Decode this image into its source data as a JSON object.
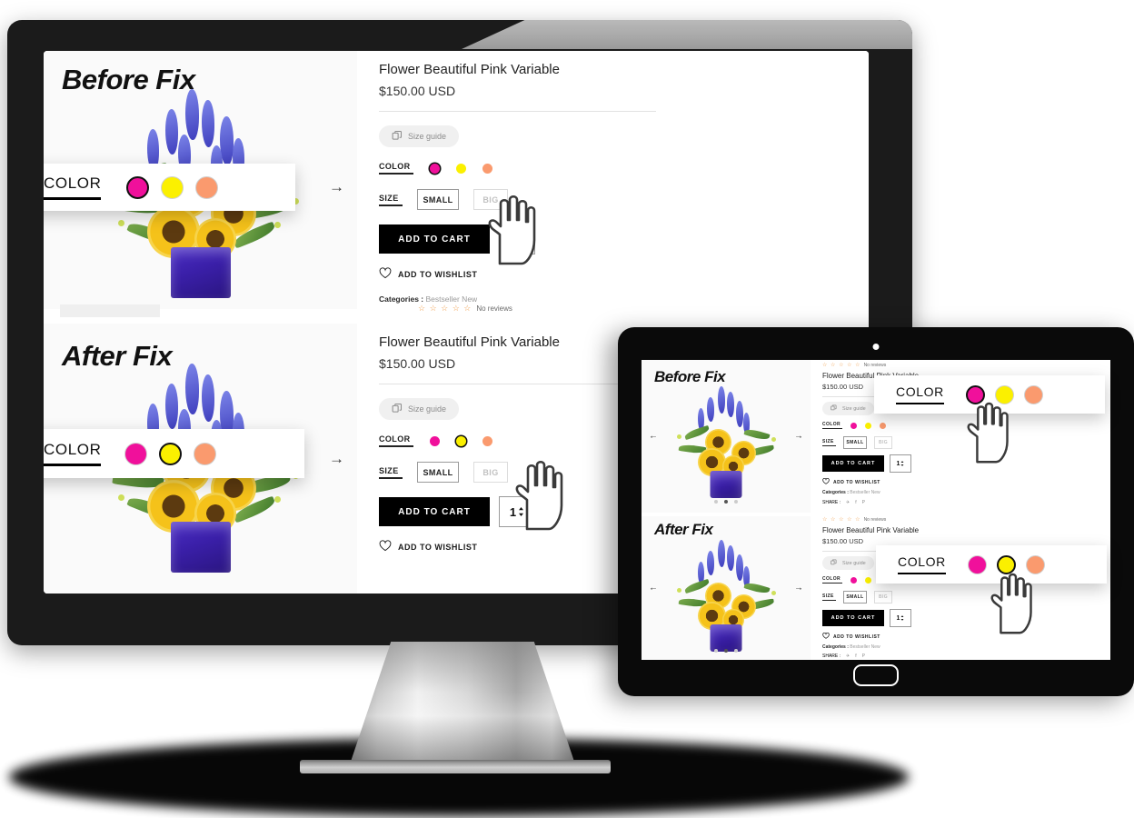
{
  "devices": {
    "monitor": {
      "name": "desktop-monitor"
    },
    "tablet": {
      "name": "tablet-device"
    }
  },
  "labels": {
    "before_fix": "Before Fix",
    "after_fix": "After Fix"
  },
  "product": {
    "title": "Flower Beautiful Pink Variable",
    "price": "$150.00 USD",
    "size_guide": "Size guide",
    "color_label": "COLOR",
    "size_label": "SIZE",
    "size_options": [
      "SMALL",
      "BIG"
    ],
    "add_to_cart": "ADD TO CART",
    "quantity": "1",
    "wishlist": "ADD TO WISHLIST",
    "categories_key": "Categories :",
    "categories_value": "Bestseller New",
    "share_key": "SHARE :",
    "share_icons": [
      "twitter-icon",
      "facebook-icon",
      "pinterest-icon"
    ],
    "reviews_text": "No reviews",
    "stars": "☆ ☆ ☆ ☆ ☆",
    "prev_arrow": "←",
    "next_arrow": "→"
  },
  "colors": {
    "pink": "#F0109B",
    "yellow": "#FBF000",
    "orange": "#FA9A6E",
    "swatch_ring": "#D6D6D6",
    "accent_black": "#000000",
    "bezel": "#1B1B1B",
    "tablet_bezel": "#0A0A0A",
    "page_bg": "#FFFFFF",
    "media_bg": "#FAFAFA"
  },
  "callouts": [
    {
      "id": "monitor-before",
      "label": "COLOR",
      "selected_index": 0
    },
    {
      "id": "monitor-after",
      "label": "COLOR",
      "selected_index": 1
    },
    {
      "id": "tablet-before",
      "label": "COLOR",
      "selected_index": 0
    },
    {
      "id": "tablet-after",
      "label": "COLOR",
      "selected_index": 1
    }
  ],
  "swatch_list": [
    "pink",
    "yellow",
    "orange"
  ]
}
